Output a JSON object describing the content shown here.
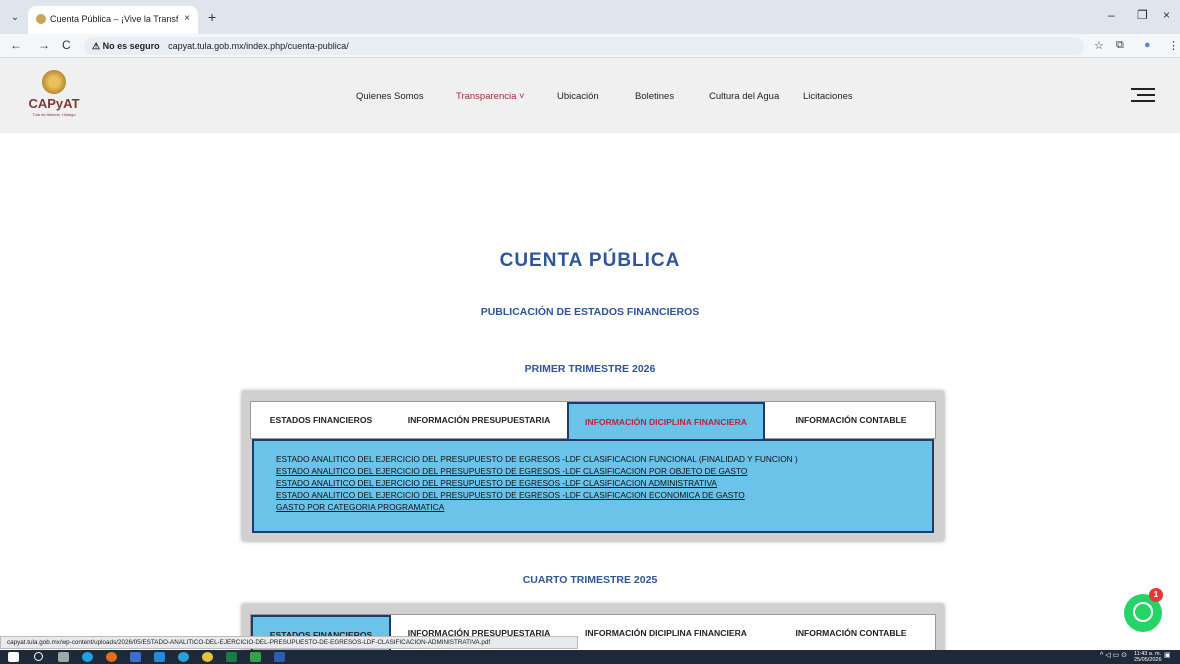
{
  "browser": {
    "tab_title": "Cuenta Pública – ¡Vive la Transf",
    "tab_close": "×",
    "new_tab": "+",
    "back": "←",
    "forward": "→",
    "reload": "C",
    "security_warning": "⚠ No es seguro",
    "url": "capyat.tula.gob.mx/index.php/cuenta-publica/",
    "min": "–",
    "max": "❐",
    "close": "×"
  },
  "site": {
    "logo_text": "CAPyAT",
    "logo_sub": "Tula de Allende, Hidalgo",
    "nav": [
      {
        "label": "Quienes Somos"
      },
      {
        "label": "Transparencia ˅"
      },
      {
        "label": "Ubicación"
      },
      {
        "label": "Boletines"
      },
      {
        "label": "Cultura del Agua"
      },
      {
        "label": "Licitaciones"
      }
    ]
  },
  "page": {
    "title": "CUENTA PÚBLICA",
    "subtitle": "PUBLICACIÓN DE ESTADOS FINANCIEROS",
    "section1": "PRIMER TRIMESTRE 2026",
    "section2": "CUARTO TRIMESTRE 2025"
  },
  "panel1": {
    "tabs": [
      {
        "label": "ESTADOS FINANCIEROS"
      },
      {
        "label": "INFORMACIÓN PRESUPUESTARIA"
      },
      {
        "label": "INFORMACIÓN DICIPLINA FINANCIERA"
      },
      {
        "label": "INFORMACIÓN CONTABLE"
      }
    ],
    "active_tab": 2,
    "items": [
      {
        "label": "ESTADO ANALITICO DEL EJERCICIO DEL PRESUPUESTO DE EGRESOS -LDF CLASIFICACION FUNCIONAL (FINALIDAD Y FUNCION )"
      },
      {
        "label": "ESTADO ANALITICO DEL EJERCICIO DEL PRESUPUESTO DE EGRESOS -LDF CLASIFICACION POR OBJETO DE GASTO"
      },
      {
        "label": "ESTADO ANALITICO DEL EJERCICIO DEL PRESUPUESTO DE EGRESOS -LDF CLASIFICACION ADMINISTRATIVA"
      },
      {
        "label": "ESTADO ANALITICO DEL EJERCICIO DEL PRESUPUESTO DE EGRESOS -LDF CLASIFICACION ECONOMICA DE GASTO"
      },
      {
        "label": "GASTO POR CATEGORIA PROGRAMATICA"
      }
    ]
  },
  "panel2": {
    "tabs": [
      {
        "label": "ESTADOS FINANCIEROS"
      },
      {
        "label": "INFORMACIÓN PRESUPUESTARIA"
      },
      {
        "label": "INFORMACIÓN DICIPLINA FINANCIERA"
      },
      {
        "label": "INFORMACIÓN CONTABLE"
      }
    ],
    "active_tab": 0
  },
  "status_url": "capyat.tula.gob.mx/wp-content/uploads/2026/05/ESTADO-ANALITICO-DEL-EJERCICIO-DEL-PRESUPUESTO-DE-EGRESOS-LDF-CLASIFICACION-ADMINISTRATIVA.pdf",
  "whatsapp": {
    "badge": "1"
  },
  "taskbar": {
    "time": "11:43 a. m.",
    "date": "25/05/2026"
  },
  "colors": {
    "accent": "#2f5597",
    "active_nav": "#9a2e3a",
    "tab_content_bg": "#6cc3ea",
    "active_tab_text": "#b3273d"
  }
}
